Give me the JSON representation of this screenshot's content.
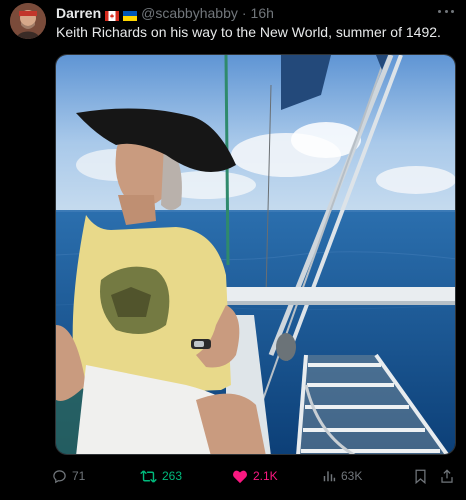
{
  "tweet": {
    "author_name": "Darren",
    "handle": "@scabbyhabby",
    "separator": "·",
    "time": "16h",
    "text": "Keith Richards on his way to the New World, summer of 1492."
  },
  "actions": {
    "replies": "71",
    "reposts": "263",
    "likes": "2.1K",
    "views": "63K"
  },
  "colors": {
    "background": "#000000",
    "secondary_text": "#71767b",
    "repost_active": "#00ba7c",
    "like_active": "#f91880"
  },
  "icons": [
    "canada-flag-icon",
    "ukraine-flag-icon",
    "more-icon",
    "reply-icon",
    "repost-icon",
    "like-icon",
    "views-icon",
    "bookmark-icon",
    "share-icon"
  ]
}
